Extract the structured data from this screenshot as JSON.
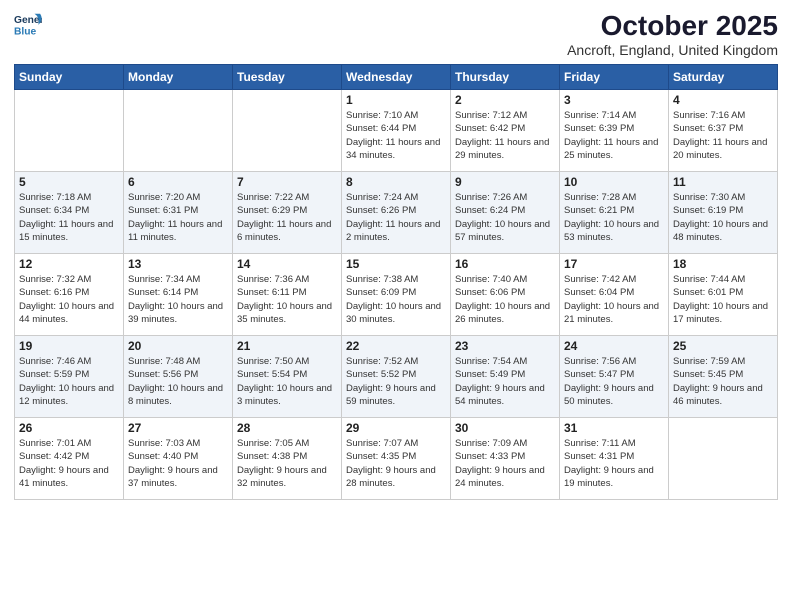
{
  "header": {
    "logo_line1": "General",
    "logo_line2": "Blue",
    "month": "October 2025",
    "location": "Ancroft, England, United Kingdom"
  },
  "weekdays": [
    "Sunday",
    "Monday",
    "Tuesday",
    "Wednesday",
    "Thursday",
    "Friday",
    "Saturday"
  ],
  "weeks": [
    [
      {
        "day": "",
        "sunrise": "",
        "sunset": "",
        "daylight": ""
      },
      {
        "day": "",
        "sunrise": "",
        "sunset": "",
        "daylight": ""
      },
      {
        "day": "",
        "sunrise": "",
        "sunset": "",
        "daylight": ""
      },
      {
        "day": "1",
        "sunrise": "Sunrise: 7:10 AM",
        "sunset": "Sunset: 6:44 PM",
        "daylight": "Daylight: 11 hours and 34 minutes."
      },
      {
        "day": "2",
        "sunrise": "Sunrise: 7:12 AM",
        "sunset": "Sunset: 6:42 PM",
        "daylight": "Daylight: 11 hours and 29 minutes."
      },
      {
        "day": "3",
        "sunrise": "Sunrise: 7:14 AM",
        "sunset": "Sunset: 6:39 PM",
        "daylight": "Daylight: 11 hours and 25 minutes."
      },
      {
        "day": "4",
        "sunrise": "Sunrise: 7:16 AM",
        "sunset": "Sunset: 6:37 PM",
        "daylight": "Daylight: 11 hours and 20 minutes."
      }
    ],
    [
      {
        "day": "5",
        "sunrise": "Sunrise: 7:18 AM",
        "sunset": "Sunset: 6:34 PM",
        "daylight": "Daylight: 11 hours and 15 minutes."
      },
      {
        "day": "6",
        "sunrise": "Sunrise: 7:20 AM",
        "sunset": "Sunset: 6:31 PM",
        "daylight": "Daylight: 11 hours and 11 minutes."
      },
      {
        "day": "7",
        "sunrise": "Sunrise: 7:22 AM",
        "sunset": "Sunset: 6:29 PM",
        "daylight": "Daylight: 11 hours and 6 minutes."
      },
      {
        "day": "8",
        "sunrise": "Sunrise: 7:24 AM",
        "sunset": "Sunset: 6:26 PM",
        "daylight": "Daylight: 11 hours and 2 minutes."
      },
      {
        "day": "9",
        "sunrise": "Sunrise: 7:26 AM",
        "sunset": "Sunset: 6:24 PM",
        "daylight": "Daylight: 10 hours and 57 minutes."
      },
      {
        "day": "10",
        "sunrise": "Sunrise: 7:28 AM",
        "sunset": "Sunset: 6:21 PM",
        "daylight": "Daylight: 10 hours and 53 minutes."
      },
      {
        "day": "11",
        "sunrise": "Sunrise: 7:30 AM",
        "sunset": "Sunset: 6:19 PM",
        "daylight": "Daylight: 10 hours and 48 minutes."
      }
    ],
    [
      {
        "day": "12",
        "sunrise": "Sunrise: 7:32 AM",
        "sunset": "Sunset: 6:16 PM",
        "daylight": "Daylight: 10 hours and 44 minutes."
      },
      {
        "day": "13",
        "sunrise": "Sunrise: 7:34 AM",
        "sunset": "Sunset: 6:14 PM",
        "daylight": "Daylight: 10 hours and 39 minutes."
      },
      {
        "day": "14",
        "sunrise": "Sunrise: 7:36 AM",
        "sunset": "Sunset: 6:11 PM",
        "daylight": "Daylight: 10 hours and 35 minutes."
      },
      {
        "day": "15",
        "sunrise": "Sunrise: 7:38 AM",
        "sunset": "Sunset: 6:09 PM",
        "daylight": "Daylight: 10 hours and 30 minutes."
      },
      {
        "day": "16",
        "sunrise": "Sunrise: 7:40 AM",
        "sunset": "Sunset: 6:06 PM",
        "daylight": "Daylight: 10 hours and 26 minutes."
      },
      {
        "day": "17",
        "sunrise": "Sunrise: 7:42 AM",
        "sunset": "Sunset: 6:04 PM",
        "daylight": "Daylight: 10 hours and 21 minutes."
      },
      {
        "day": "18",
        "sunrise": "Sunrise: 7:44 AM",
        "sunset": "Sunset: 6:01 PM",
        "daylight": "Daylight: 10 hours and 17 minutes."
      }
    ],
    [
      {
        "day": "19",
        "sunrise": "Sunrise: 7:46 AM",
        "sunset": "Sunset: 5:59 PM",
        "daylight": "Daylight: 10 hours and 12 minutes."
      },
      {
        "day": "20",
        "sunrise": "Sunrise: 7:48 AM",
        "sunset": "Sunset: 5:56 PM",
        "daylight": "Daylight: 10 hours and 8 minutes."
      },
      {
        "day": "21",
        "sunrise": "Sunrise: 7:50 AM",
        "sunset": "Sunset: 5:54 PM",
        "daylight": "Daylight: 10 hours and 3 minutes."
      },
      {
        "day": "22",
        "sunrise": "Sunrise: 7:52 AM",
        "sunset": "Sunset: 5:52 PM",
        "daylight": "Daylight: 9 hours and 59 minutes."
      },
      {
        "day": "23",
        "sunrise": "Sunrise: 7:54 AM",
        "sunset": "Sunset: 5:49 PM",
        "daylight": "Daylight: 9 hours and 54 minutes."
      },
      {
        "day": "24",
        "sunrise": "Sunrise: 7:56 AM",
        "sunset": "Sunset: 5:47 PM",
        "daylight": "Daylight: 9 hours and 50 minutes."
      },
      {
        "day": "25",
        "sunrise": "Sunrise: 7:59 AM",
        "sunset": "Sunset: 5:45 PM",
        "daylight": "Daylight: 9 hours and 46 minutes."
      }
    ],
    [
      {
        "day": "26",
        "sunrise": "Sunrise: 7:01 AM",
        "sunset": "Sunset: 4:42 PM",
        "daylight": "Daylight: 9 hours and 41 minutes."
      },
      {
        "day": "27",
        "sunrise": "Sunrise: 7:03 AM",
        "sunset": "Sunset: 4:40 PM",
        "daylight": "Daylight: 9 hours and 37 minutes."
      },
      {
        "day": "28",
        "sunrise": "Sunrise: 7:05 AM",
        "sunset": "Sunset: 4:38 PM",
        "daylight": "Daylight: 9 hours and 32 minutes."
      },
      {
        "day": "29",
        "sunrise": "Sunrise: 7:07 AM",
        "sunset": "Sunset: 4:35 PM",
        "daylight": "Daylight: 9 hours and 28 minutes."
      },
      {
        "day": "30",
        "sunrise": "Sunrise: 7:09 AM",
        "sunset": "Sunset: 4:33 PM",
        "daylight": "Daylight: 9 hours and 24 minutes."
      },
      {
        "day": "31",
        "sunrise": "Sunrise: 7:11 AM",
        "sunset": "Sunset: 4:31 PM",
        "daylight": "Daylight: 9 hours and 19 minutes."
      },
      {
        "day": "",
        "sunrise": "",
        "sunset": "",
        "daylight": ""
      }
    ]
  ]
}
